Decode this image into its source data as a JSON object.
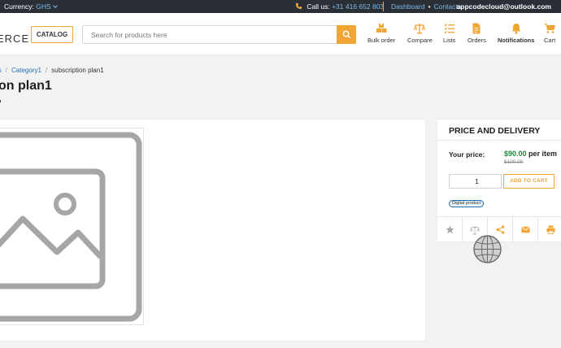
{
  "topbar": {
    "currency_label": "Currency:",
    "currency_value": "GHS",
    "call_label": "Call us:",
    "phone": "+31 416 652 803",
    "dashboard": "Dashboard",
    "contacts": "Contacts",
    "dot": "•",
    "email": "appcodecloud@outlook.com"
  },
  "header": {
    "logo_fragment": "ERCE",
    "catalog_label": "CATALOG",
    "search_placeholder": "Search for products here",
    "nav": {
      "bulk_order": "Bulk order",
      "compare": "Compare",
      "lists": "Lists",
      "orders": "Orders",
      "notifications": "Notifications",
      "cart": "Cart"
    }
  },
  "breadcrumb": {
    "item1": "ls",
    "item2": "Category1",
    "item3": "subscription plan1",
    "separator": "/"
  },
  "product": {
    "title_fragment": "on plan1"
  },
  "price_panel": {
    "heading": "PRICE AND DELIVERY",
    "your_price_label": "Your price:",
    "price": "$90.00",
    "per_unit": "per item",
    "old_price": "$100.00",
    "quantity": "1",
    "add_to_cart": "ADD TO CART",
    "badge": "Digital product"
  },
  "colors": {
    "accent": "#f0a535",
    "link": "#1f6fb2",
    "price_green": "#1a8a3a",
    "topbar_bg": "#2a2f36"
  }
}
